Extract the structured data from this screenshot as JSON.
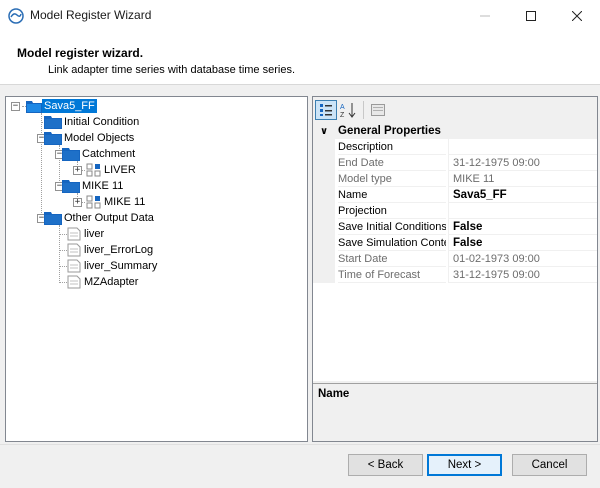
{
  "window": {
    "title": "Model Register Wizard"
  },
  "header": {
    "title": "Model register wizard.",
    "subtitle": "Link adapter time series with database time series."
  },
  "tree": {
    "root": "Sava5_FF",
    "initial_condition": "Initial Condition",
    "model_objects": "Model Objects",
    "catchment": "Catchment",
    "liver_model": "LIVER",
    "mike11_group": "MIKE 11",
    "mike11_model": "MIKE 11",
    "other_output": "Other Output Data",
    "outputs": [
      "liver",
      "liver_ErrorLog",
      "liver_Summary",
      "MZAdapter"
    ]
  },
  "properties": {
    "category": "General Properties",
    "rows": [
      {
        "name": "Description",
        "value": "",
        "readonly": false,
        "bold": false
      },
      {
        "name": "End Date",
        "value": "31-12-1975 09:00",
        "readonly": true,
        "bold": false
      },
      {
        "name": "Model type",
        "value": "MIKE 11",
        "readonly": true,
        "bold": false
      },
      {
        "name": "Name",
        "value": "Sava5_FF",
        "readonly": false,
        "bold": true
      },
      {
        "name": "Projection",
        "value": "",
        "readonly": false,
        "bold": false
      },
      {
        "name": "Save Initial Conditions to",
        "value": "False",
        "readonly": false,
        "bold": true
      },
      {
        "name": "Save Simulation Content",
        "value": "False",
        "readonly": false,
        "bold": true
      },
      {
        "name": "Start Date",
        "value": "01-02-1973 09:00",
        "readonly": true,
        "bold": false
      },
      {
        "name": "Time of Forecast",
        "value": "31-12-1975 09:00",
        "readonly": true,
        "bold": false
      }
    ],
    "description_title": "Name"
  },
  "buttons": {
    "back": "< Back",
    "next": "Next >",
    "cancel": "Cancel"
  },
  "colors": {
    "accent": "#0078d7",
    "folder": "#1565c0"
  }
}
